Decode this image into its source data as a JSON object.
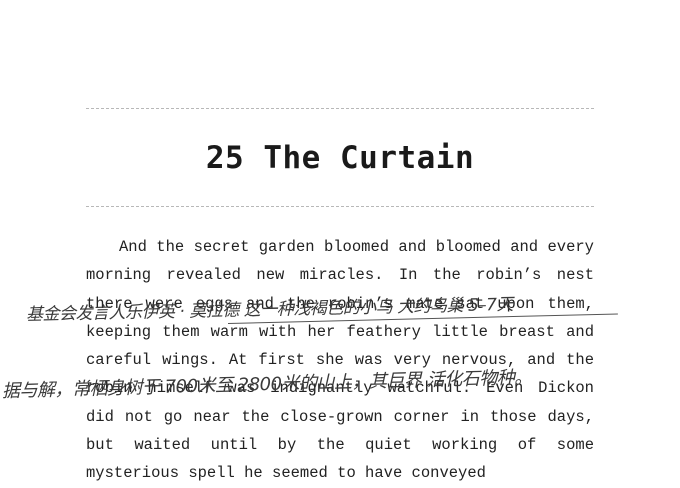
{
  "chapter": {
    "title": "25 The Curtain"
  },
  "body": {
    "paragraph": "And the secret garden bloomed and bloomed and every morning revealed new miracles. In the robin’s nest there were eggs and the robin’s mate sat upon them, keeping them warm with her feathery little breast and careful wings. At first she was very nervous, and the robin himself was indignantly watchful. Even Dickon did not go near the close-grown corner in those days, but waited until by the quiet working of some mysterious spell he seemed to have conveyed"
  },
  "annotations": [
    "基金会发言人乐伊英 · 莫拉德 这一种浅褐色的小鸟 大约鸟巢 5–7天",
    "据与解，常栖身树于 700米至 2800米的山上，其巨界 活化石物种。"
  ]
}
